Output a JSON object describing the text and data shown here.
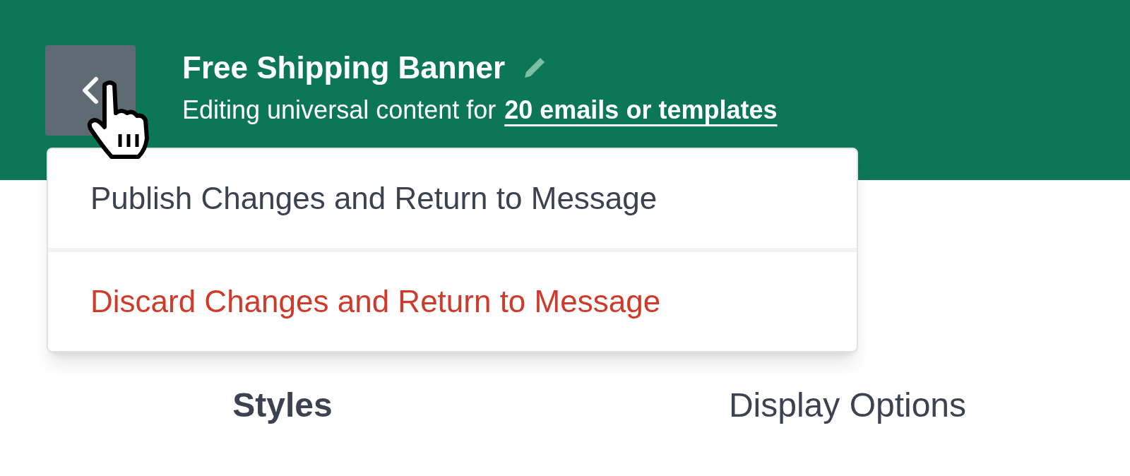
{
  "header": {
    "title": "Free Shipping Banner",
    "subtitle": "Editing universal content for",
    "link": "20 emails or templates"
  },
  "menu": {
    "items": [
      {
        "label": "Publish Changes and Return to Message",
        "kind": "normal"
      },
      {
        "label": "Discard Changes and Return to Message",
        "kind": "danger"
      }
    ]
  },
  "tabs": [
    {
      "label": "Styles",
      "selected": true
    },
    {
      "label": "Display Options",
      "selected": false
    }
  ]
}
